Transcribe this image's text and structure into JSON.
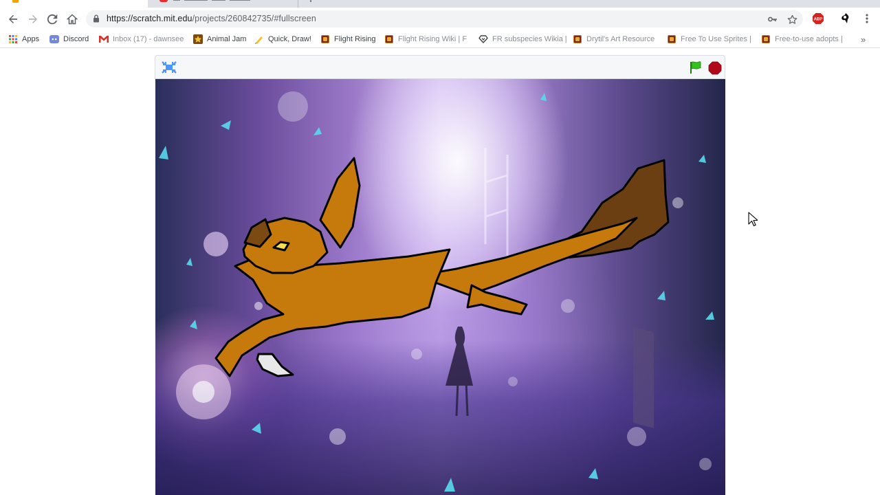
{
  "browser": {
    "url_domain": "https://scratch.mit.edu",
    "url_path": "/projects/260842735/#fullscreen",
    "bookmarks": [
      {
        "label": "Apps",
        "icon": "apps-grid-icon"
      },
      {
        "label": "Discord",
        "icon": "discord-icon"
      },
      {
        "label": "Inbox (17) - dawnsee",
        "icon": "gmail-icon"
      },
      {
        "label": "Animal Jam",
        "icon": "animal-jam-icon"
      },
      {
        "label": "Quick, Draw!",
        "icon": "quick-draw-icon"
      },
      {
        "label": "Flight Rising",
        "icon": "flight-rising-icon"
      },
      {
        "label": "Flight Rising Wiki | F",
        "icon": "flight-rising-icon"
      },
      {
        "label": "FR subspecies Wikia |",
        "icon": "wikia-icon"
      },
      {
        "label": "Drytil's Art Resource",
        "icon": "flight-rising-icon"
      },
      {
        "label": "Free To Use Sprites |",
        "icon": "flight-rising-icon"
      },
      {
        "label": "Free-to-use adopts |",
        "icon": "flight-rising-icon"
      }
    ],
    "bookmarks_more": "»",
    "extension_abp": "ABP"
  },
  "player": {
    "fullscreen_icon": "exit-fullscreen-icon",
    "green_flag_icon": "green-flag-icon",
    "stop_icon": "stop-sign-icon",
    "colors": {
      "flag": "#34c21e",
      "stop": "#b0091a",
      "fullscreen": "#4c97ff",
      "sprite_body": "#c67a0c",
      "sprite_tail_tip": "#6b3f12"
    }
  }
}
